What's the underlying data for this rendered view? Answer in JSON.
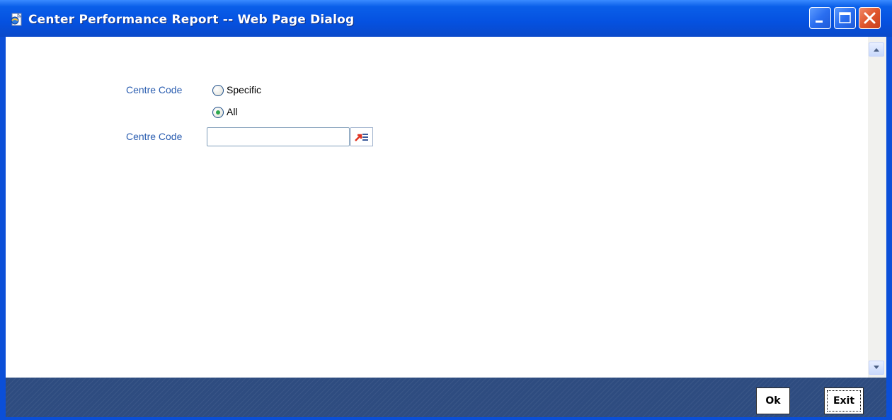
{
  "window": {
    "title": "Center Performance Report -- Web Page Dialog"
  },
  "form": {
    "centre_code_type_label": "Centre Code",
    "options": [
      {
        "label": "Specific",
        "selected": false
      },
      {
        "label": "All",
        "selected": true
      }
    ],
    "centre_code_label": "Centre Code",
    "centre_code_value": ""
  },
  "footer": {
    "ok_label": "Ok",
    "exit_label": "Exit"
  },
  "icons": {
    "window": "ie-page-icon",
    "minimize": "minimize-icon",
    "maximize": "maximize-icon",
    "close": "close-icon",
    "lov": "list-of-values-icon",
    "scroll_up": "scroll-up-arrow-icon",
    "scroll_down": "scroll-down-arrow-icon"
  },
  "colors": {
    "titlebar": "#0551e0",
    "label": "#2a5db0",
    "footer": "#2e4c80",
    "radio_selected": "#2fa84f"
  }
}
